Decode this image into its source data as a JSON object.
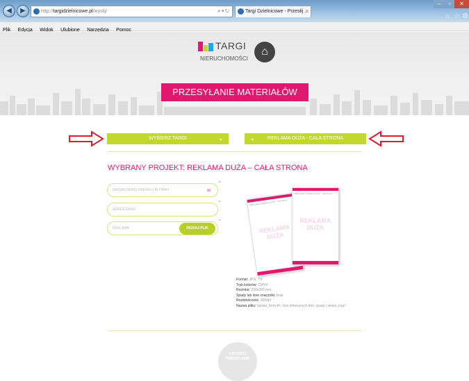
{
  "browser": {
    "url_prefix": "http://",
    "url_domain": "targidzielnicowe.pl",
    "url_path": "/wyslij/",
    "url_controls": "⌕ ▾ ↻",
    "tab_title": "Targi Dzielnicowe - Przesłij ...",
    "tab_close": "×",
    "menu": [
      "Plik",
      "Edycja",
      "Widok",
      "Ulubione",
      "Narzędzia",
      "Pomoc"
    ]
  },
  "logo": {
    "text": "TARGI",
    "subtext": "NIERUCHOMOŚCI"
  },
  "banner": {
    "title": "PRZESYŁANIE MATERIAŁÓW"
  },
  "selectors": {
    "fair": "WYBIERZ TARGI",
    "ad": "REKLAMA DUŻA - CAŁA STRONA"
  },
  "project": {
    "title": "WYBRANY PROJEKT: REKLAMA DUŻA – CAŁA STRONA"
  },
  "form": {
    "developer_placeholder": "NAZWA DEWELOPERA LUB FIRMY",
    "email_placeholder": "ADRES EMAIL",
    "ad_placeholder": "REKLAMA",
    "upload_label": "WGRAJ PLIK",
    "required_mark": "*"
  },
  "preview": {
    "watermark": "REKLAMA DUŻA",
    "header_text": "REKLAMA • Reklama duża – cała strona"
  },
  "specs": [
    {
      "label": "Format:",
      "value": "JPG, TIF"
    },
    {
      "label": "Tryb kolorów:",
      "value": "CMYK"
    },
    {
      "label": "Rozmiar:",
      "value": "230x280 mm"
    },
    {
      "label": "Spady lub inne znaczniki:",
      "value": "brak"
    },
    {
      "label": "Rozdzielczość:",
      "value": "300dpi"
    },
    {
      "label": "Nazwa pliku:",
      "value": "nazwa_firmy.tif - bez śmiesznych liter, spacji i słowa „logo”"
    }
  ],
  "finish": {
    "label": "ZAKOŃCZ",
    "sub": "PRZESYŁANIE"
  },
  "colors": {
    "accent": "#e0186e",
    "lime": "#c3d82e",
    "arrow": "#e01a2d"
  }
}
